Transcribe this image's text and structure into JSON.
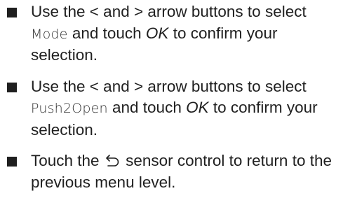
{
  "instructions": {
    "items": [
      {
        "text_1": "Use the < and > arrow buttons to select ",
        "display_text": "Mode",
        "text_2": " and touch ",
        "emphasis": "OK",
        "text_3": " to confirm your selection."
      },
      {
        "text_1": "Use the < and > arrow buttons to select ",
        "display_text": "Push2Open",
        "text_2": " and touch ",
        "emphasis": "OK",
        "text_3": " to confirm your selection."
      },
      {
        "text_1": "Touch the ",
        "icon": "back-arrow-icon",
        "text_2": " sensor control to return to the previous menu level."
      }
    ]
  }
}
